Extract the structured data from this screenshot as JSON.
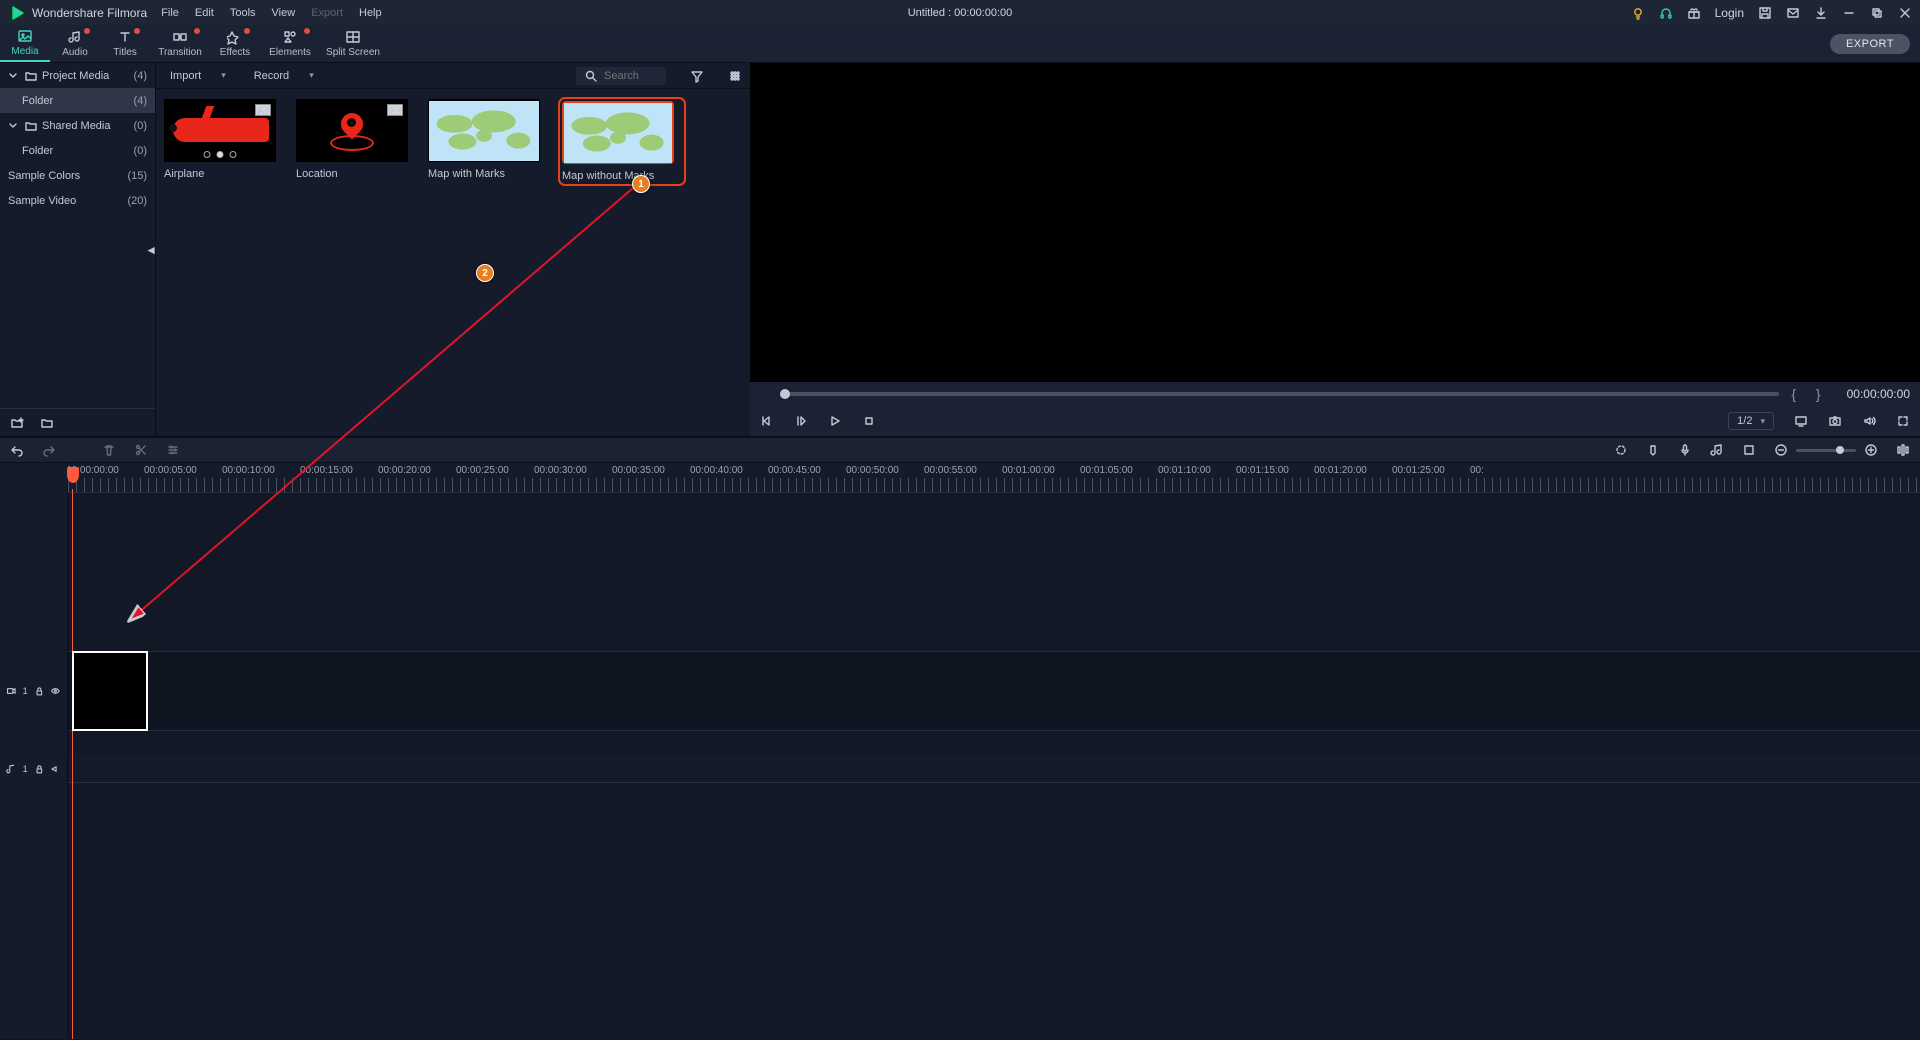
{
  "app": {
    "name": "Wondershare Filmora",
    "title_center": "Untitled : 00:00:00:00"
  },
  "menu": {
    "file": "File",
    "edit": "Edit",
    "tools": "Tools",
    "view": "View",
    "export": "Export",
    "help": "Help"
  },
  "titlebar_right": {
    "login": "Login"
  },
  "tabs": {
    "media": "Media",
    "audio": "Audio",
    "titles": "Titles",
    "transition": "Transition",
    "effects": "Effects",
    "elements": "Elements",
    "splitscreen": "Split Screen",
    "export_btn": "EXPORT"
  },
  "sidebar": {
    "project_media": {
      "label": "Project Media",
      "count": "(4)"
    },
    "folder1": {
      "label": "Folder",
      "count": "(4)"
    },
    "shared_media": {
      "label": "Shared Media",
      "count": "(0)"
    },
    "folder2": {
      "label": "Folder",
      "count": "(0)"
    },
    "sample_colors": {
      "label": "Sample Colors",
      "count": "(15)"
    },
    "sample_video": {
      "label": "Sample Video",
      "count": "(20)"
    }
  },
  "media_top": {
    "import": "Import",
    "record": "Record",
    "search_ph": "Search"
  },
  "thumbs": {
    "airplane": "Airplane",
    "location": "Location",
    "map_marks": "Map with Marks",
    "map_nomarks": "Map without Marks"
  },
  "preview": {
    "time": "00:00:00:00",
    "ratio": "1/2"
  },
  "timeline": {
    "marks": [
      "00:00:00:00",
      "00:00:05:00",
      "00:00:10:00",
      "00:00:15:00",
      "00:00:20:00",
      "00:00:25:00",
      "00:00:30:00",
      "00:00:35:00",
      "00:00:40:00",
      "00:00:45:00",
      "00:00:50:00",
      "00:00:55:00",
      "00:01:00:00",
      "00:01:05:00",
      "00:01:10:00",
      "00:01:15:00",
      "00:01:20:00",
      "00:01:25:00",
      "00:"
    ],
    "video_track": "1",
    "audio_track": "1"
  },
  "annotations": {
    "step1": "1",
    "step2": "2"
  }
}
